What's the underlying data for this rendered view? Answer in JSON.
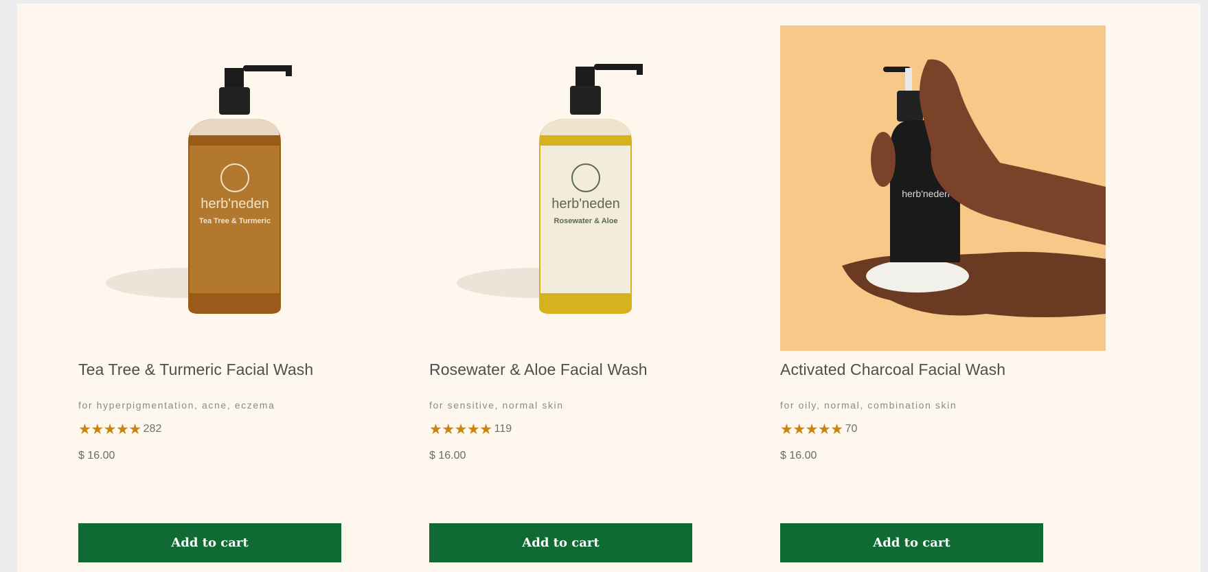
{
  "products": [
    {
      "title": "Tea Tree & Turmeric Facial Wash",
      "tagline": "for hyperpigmentation, acne, eczema",
      "stars": "★★★★★",
      "rating": 5,
      "reviews": "282",
      "price": "$ 16.00",
      "cta": "Add to cart",
      "image_label": {
        "brand": "herb'neden",
        "name": "Tea Tree & Turmeric"
      }
    },
    {
      "title": "Rosewater & Aloe Facial Wash",
      "tagline": "for sensitive, normal skin",
      "stars": "★★★★★",
      "rating": 5,
      "reviews": "119",
      "price": "$ 16.00",
      "cta": "Add to cart",
      "image_label": {
        "brand": "herb'neden",
        "name": "Rosewater & Aloe"
      }
    },
    {
      "title": "Activated Charcoal Facial Wash",
      "tagline": "for oily, normal, combination skin",
      "stars": "★★★★★",
      "rating": 5,
      "reviews": "70",
      "price": "$ 16.00",
      "cta": "Add to cart",
      "image_label": {
        "brand": "herb'neden"
      }
    }
  ],
  "colors": {
    "page_background": "#fef7ee",
    "outer_background": "#ececee",
    "button": "#0f6a33",
    "stars": "#c8860e",
    "charcoal_image_background": "#f8c889"
  }
}
